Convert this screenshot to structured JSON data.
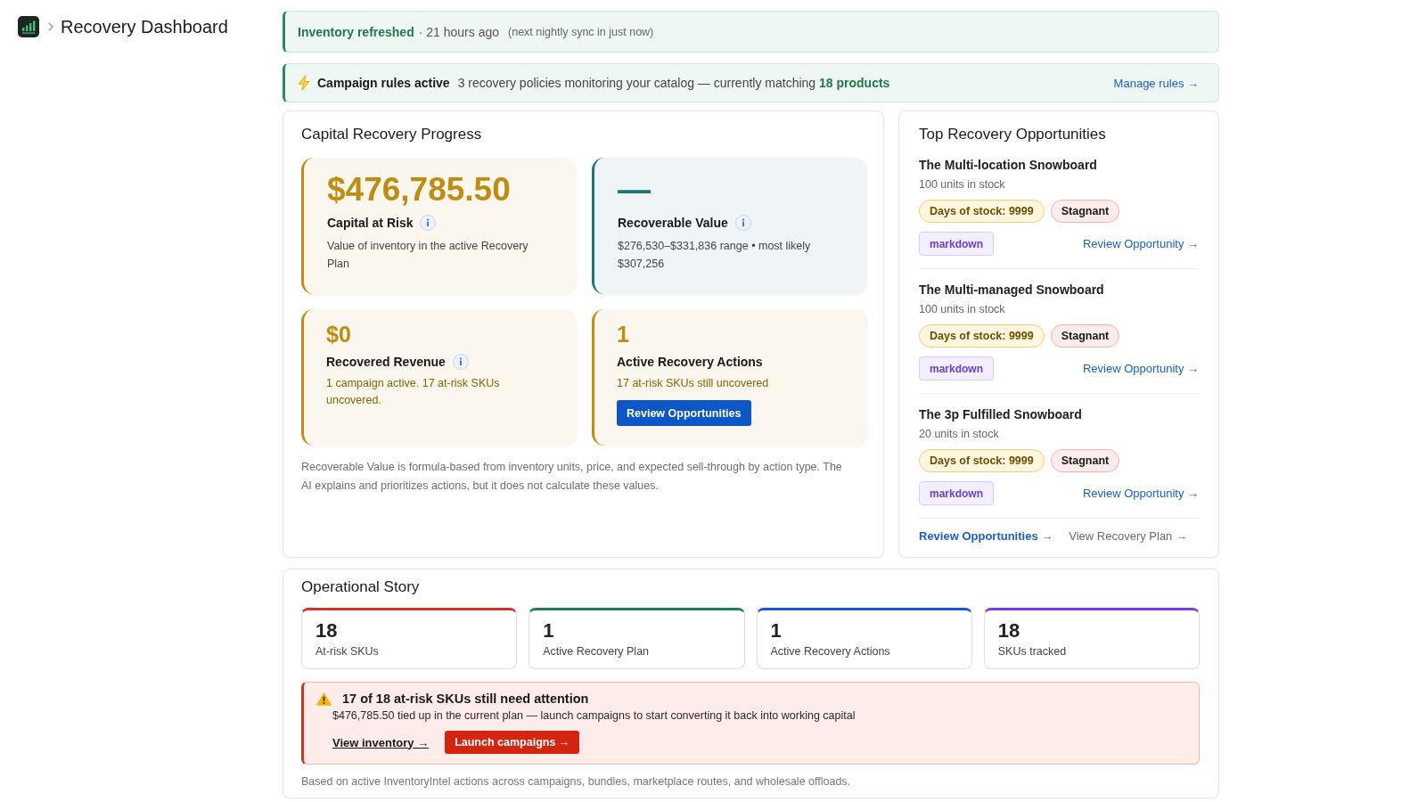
{
  "header": {
    "title": "Recovery Dashboard"
  },
  "sync_banner": {
    "status": "Inventory refreshed",
    "age": "· 21 hours ago",
    "next_sync": "(next nightly sync in just now)"
  },
  "rules_banner": {
    "title": "Campaign rules active",
    "message": "3 recovery policies monitoring your catalog — currently matching **18 products**",
    "link": "Manage rules →"
  },
  "recovery_progress": {
    "title": "Capital Recovery Progress",
    "tiles": [
      {
        "kind": "hero",
        "color": "#bf8d12",
        "value": "$476,785.50",
        "label": "Capital at Risk",
        "info": true,
        "warning": false,
        "description": "Value of inventory in the active Recovery Plan"
      },
      {
        "kind": "hero",
        "color": "#1d7479",
        "value": "—",
        "label": "Recoverable Value",
        "info": true,
        "warning": false,
        "description": "$276,530–$331,836 range • most likely $307,256"
      },
      {
        "kind": "metric",
        "color": "#bf8d12",
        "value": "$0",
        "label": "Recovered Revenue",
        "info": true,
        "warning": true,
        "description": "1 campaign active. 17 at-risk SKUs uncovered."
      },
      {
        "kind": "metric",
        "color": "#bf8d12",
        "value": "1",
        "label": "Active Recovery Actions",
        "info": false,
        "warning": true,
        "description": "17 at-risk SKUs still uncovered",
        "button": "Review Opportunities"
      }
    ],
    "footnote": "Recoverable Value is formula-based from inventory units, price, and expected sell-through by action type. The AI explains and prioritizes actions, but it does not calculate these values."
  },
  "top_opportunities": {
    "title": "Top Recovery Opportunities",
    "items": [
      {
        "name": "The Multi-location Snowboard",
        "stock": "100 units in stock",
        "tags": [
          {
            "kind": "metric",
            "text": "Days of stock: 9999"
          },
          {
            "kind": "status",
            "text": "Stagnant"
          }
        ],
        "action": "markdown",
        "link": "Review Opportunity →"
      },
      {
        "name": "The Multi-managed Snowboard",
        "stock": "100 units in stock",
        "tags": [
          {
            "kind": "metric",
            "text": "Days of stock: 9999"
          },
          {
            "kind": "status",
            "text": "Stagnant"
          }
        ],
        "action": "markdown",
        "link": "Review Opportunity →"
      },
      {
        "name": "The 3p Fulfilled Snowboard",
        "stock": "20 units in stock",
        "tags": [
          {
            "kind": "metric",
            "text": "Days of stock: 9999"
          },
          {
            "kind": "status",
            "text": "Stagnant"
          }
        ],
        "action": "markdown",
        "link": "Review Opportunity →"
      }
    ],
    "links": [
      {
        "text": "Review Opportunities →",
        "primary": true
      },
      {
        "text": "View Recovery Plan →",
        "primary": false
      }
    ]
  },
  "operational_story": {
    "title": "Operational Story",
    "stats": [
      {
        "value": "18",
        "label": "At-risk SKUs",
        "color": "#d93025"
      },
      {
        "value": "1",
        "label": "Active Recovery Plan",
        "color": "#1e7f4f"
      },
      {
        "value": "1",
        "label": "Active Recovery Actions",
        "color": "#1a56db"
      },
      {
        "value": "18",
        "label": "SKUs tracked",
        "color": "#7c3aed"
      }
    ],
    "alert": {
      "title": "17 of 18 at-risk SKUs still need attention",
      "message": "$476,785.50 tied up in the current plan — launch campaigns to start converting it back into working capital",
      "link": "View inventory →",
      "button": "Launch campaigns →"
    },
    "footnote": "Based on active InventoryIntel actions across campaigns, bundles, marketplace routes, and wholesale offloads."
  }
}
